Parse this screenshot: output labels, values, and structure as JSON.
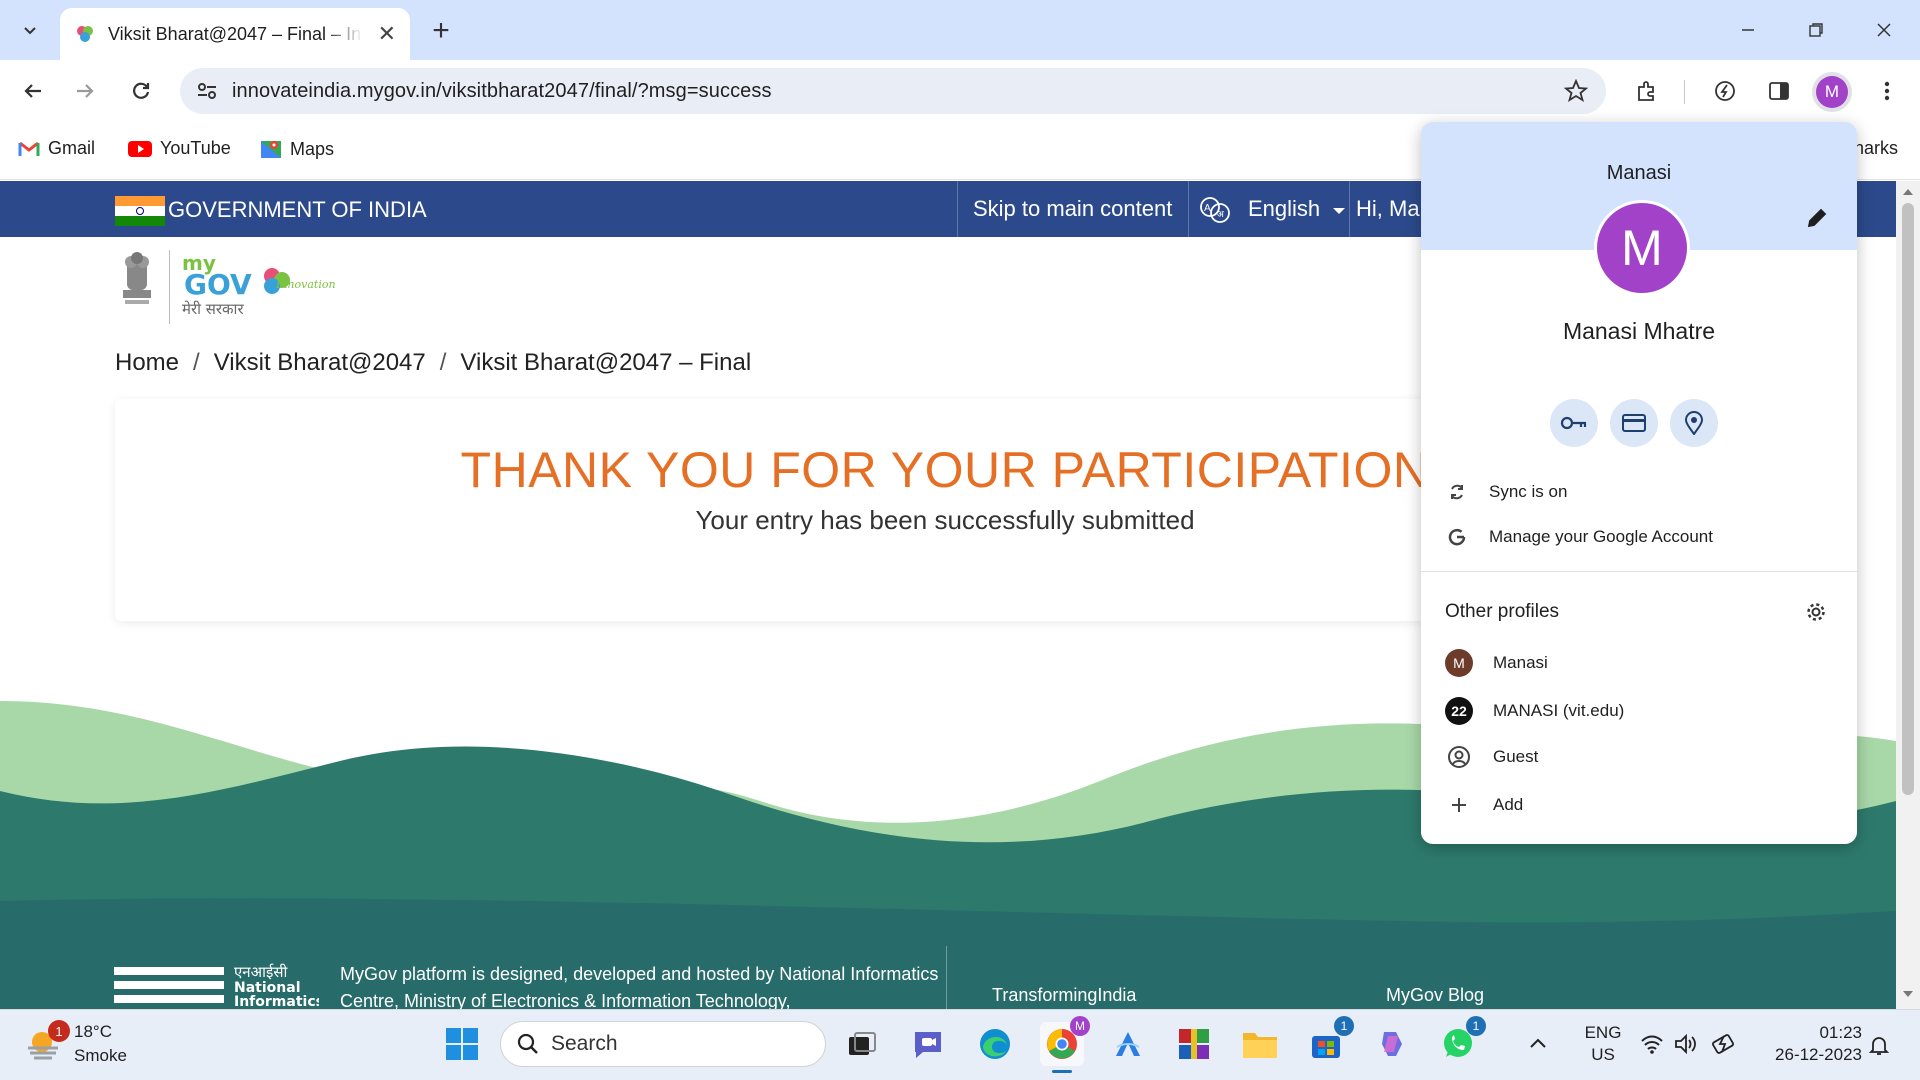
{
  "browser": {
    "tab_title": "Viksit Bharat@2047 – Final – Innovate India",
    "tab_close": "✕",
    "new_tab": "+",
    "url": "innovateindia.mygov.in/viksitbharat2047/final/?msg=success",
    "profile_initial": "M",
    "bookmarks": [
      {
        "label": "Gmail",
        "icon": "gmail-icon"
      },
      {
        "label": "YouTube",
        "icon": "youtube-icon"
      },
      {
        "label": "Maps",
        "icon": "maps-icon"
      }
    ],
    "bookmarks_right_partial": "harks",
    "accent": "#d3e3fd"
  },
  "page": {
    "gov_bar": {
      "title": "GOVERNMENT OF INDIA",
      "skip": "Skip to main content",
      "language": "English",
      "greeting": "Hi, Mar",
      "bg_color": "#2c4a8b"
    },
    "logo": {
      "emblem_caption": "सत्यमेव जयते",
      "brand_my": "my",
      "brand_gov": "GOV",
      "brand_hindi": "मेरी सरकार",
      "brand_innovation": "Innovation"
    },
    "breadcrumb": [
      "Home",
      "Viksit Bharat@2047",
      "Viksit Bharat@2047 – Final"
    ],
    "breadcrumb_sep": "/",
    "card": {
      "heading": "THANK YOU FOR YOUR PARTICIPATION",
      "message": "Your entry has been successfully submitted",
      "heading_color": "#e56f25"
    },
    "footer": {
      "nic_hindi": "एनआईसी",
      "nic_lines": [
        "National",
        "Informatics"
      ],
      "text": "MyGov platform is designed, developed and hosted by National Informatics Centre, Ministry of Electronics & Information Technology,",
      "links": [
        "TransformingIndia",
        "MyGov Blog"
      ]
    }
  },
  "profile_menu": {
    "name": "Manasi",
    "avatar_initial": "M",
    "full_name": "Manasi Mhatre",
    "quick_actions": [
      "key-icon",
      "card-icon",
      "location-pin-icon"
    ],
    "sync": "Sync is on",
    "manage": "Manage your Google Account",
    "other_profiles_label": "Other profiles",
    "profiles": [
      {
        "label": "Manasi",
        "badge": "M"
      },
      {
        "label": "MANASI (vit.edu)",
        "badge": "22"
      },
      {
        "label": "Guest",
        "badge": ""
      }
    ],
    "add": "Add",
    "avatar_color": "#a142c9"
  },
  "taskbar": {
    "weather_badge": "1",
    "temperature": "18°C",
    "condition": "Smoke",
    "search_placeholder": "Search",
    "store_badge": "1",
    "whatsapp_badge": "1",
    "lang_top": "ENG",
    "lang_bottom": "US",
    "time": "01:23",
    "date": "26-12-2023"
  }
}
